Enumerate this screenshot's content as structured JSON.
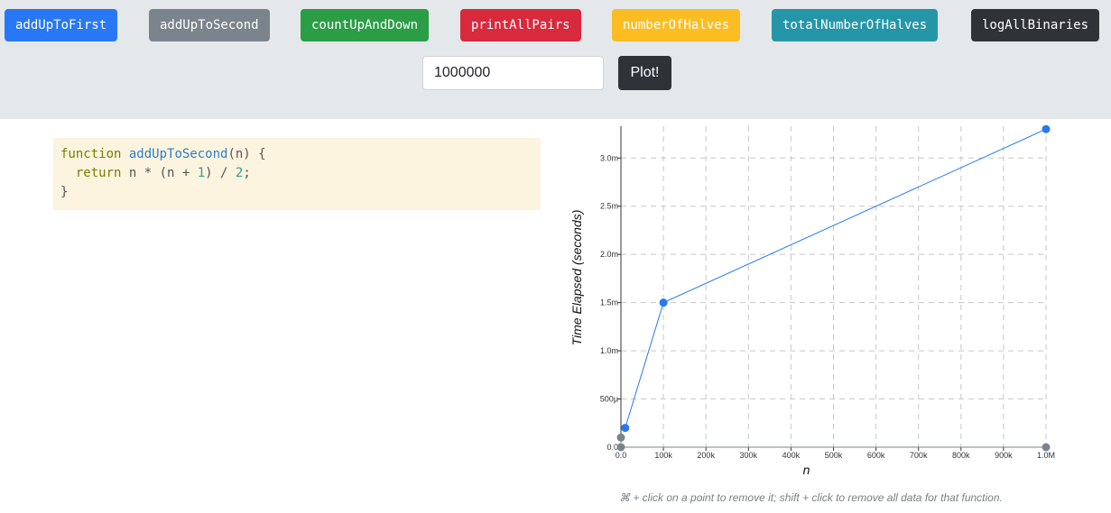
{
  "toolbar": {
    "buttons": [
      {
        "label": "addUpToFirst",
        "color": "#2878f5"
      },
      {
        "label": "addUpToSecond",
        "color": "#7b848c"
      },
      {
        "label": "countUpAndDown",
        "color": "#2a9d45"
      },
      {
        "label": "printAllPairs",
        "color": "#d9293d"
      },
      {
        "label": "numberOfHalves",
        "color": "#fbbd21"
      },
      {
        "label": "totalNumberOfHalves",
        "color": "#2596a8"
      },
      {
        "label": "logAllBinaries",
        "color": "#2f3337"
      }
    ],
    "n_input_value": "1000000",
    "plot_label": "Plot!"
  },
  "code": {
    "keyword_function": "function",
    "function_name": "addUpToSecond",
    "params": "(n) {",
    "keyword_return": "return",
    "expr_before": " n * (n + ",
    "num_one": "1",
    "expr_mid": ") / ",
    "num_two": "2",
    "expr_end": ";",
    "closing": "}"
  },
  "chart_data": {
    "type": "scatter",
    "xlabel": "n",
    "ylabel": "Time Elapsed (seconds)",
    "xlim": [
      0,
      1000000
    ],
    "ylim": [
      0,
      0.0033
    ],
    "grid": true,
    "x_ticks": [
      "0.0",
      "100k",
      "200k",
      "300k",
      "400k",
      "500k",
      "600k",
      "700k",
      "800k",
      "900k",
      "1.0M"
    ],
    "y_ticks": [
      "0.0",
      "500µ",
      "1.0m",
      "1.5m",
      "2.0m",
      "2.5m",
      "3.0m"
    ],
    "series": [
      {
        "color": "#2878f5",
        "connected": true,
        "points": [
          {
            "x": 10000,
            "y": 0.0002
          },
          {
            "x": 100000,
            "y": 0.0015
          },
          {
            "x": 1000000,
            "y": 0.0033
          }
        ]
      },
      {
        "color": "#7b848c",
        "connected": true,
        "points": [
          {
            "x": 0,
            "y": 0.0001
          },
          {
            "x": 0,
            "y": 0.0
          },
          {
            "x": 1000000,
            "y": 0.0
          }
        ]
      }
    ]
  },
  "hint": "⌘ + click on a point to remove it; shift + click to remove all data for that function."
}
